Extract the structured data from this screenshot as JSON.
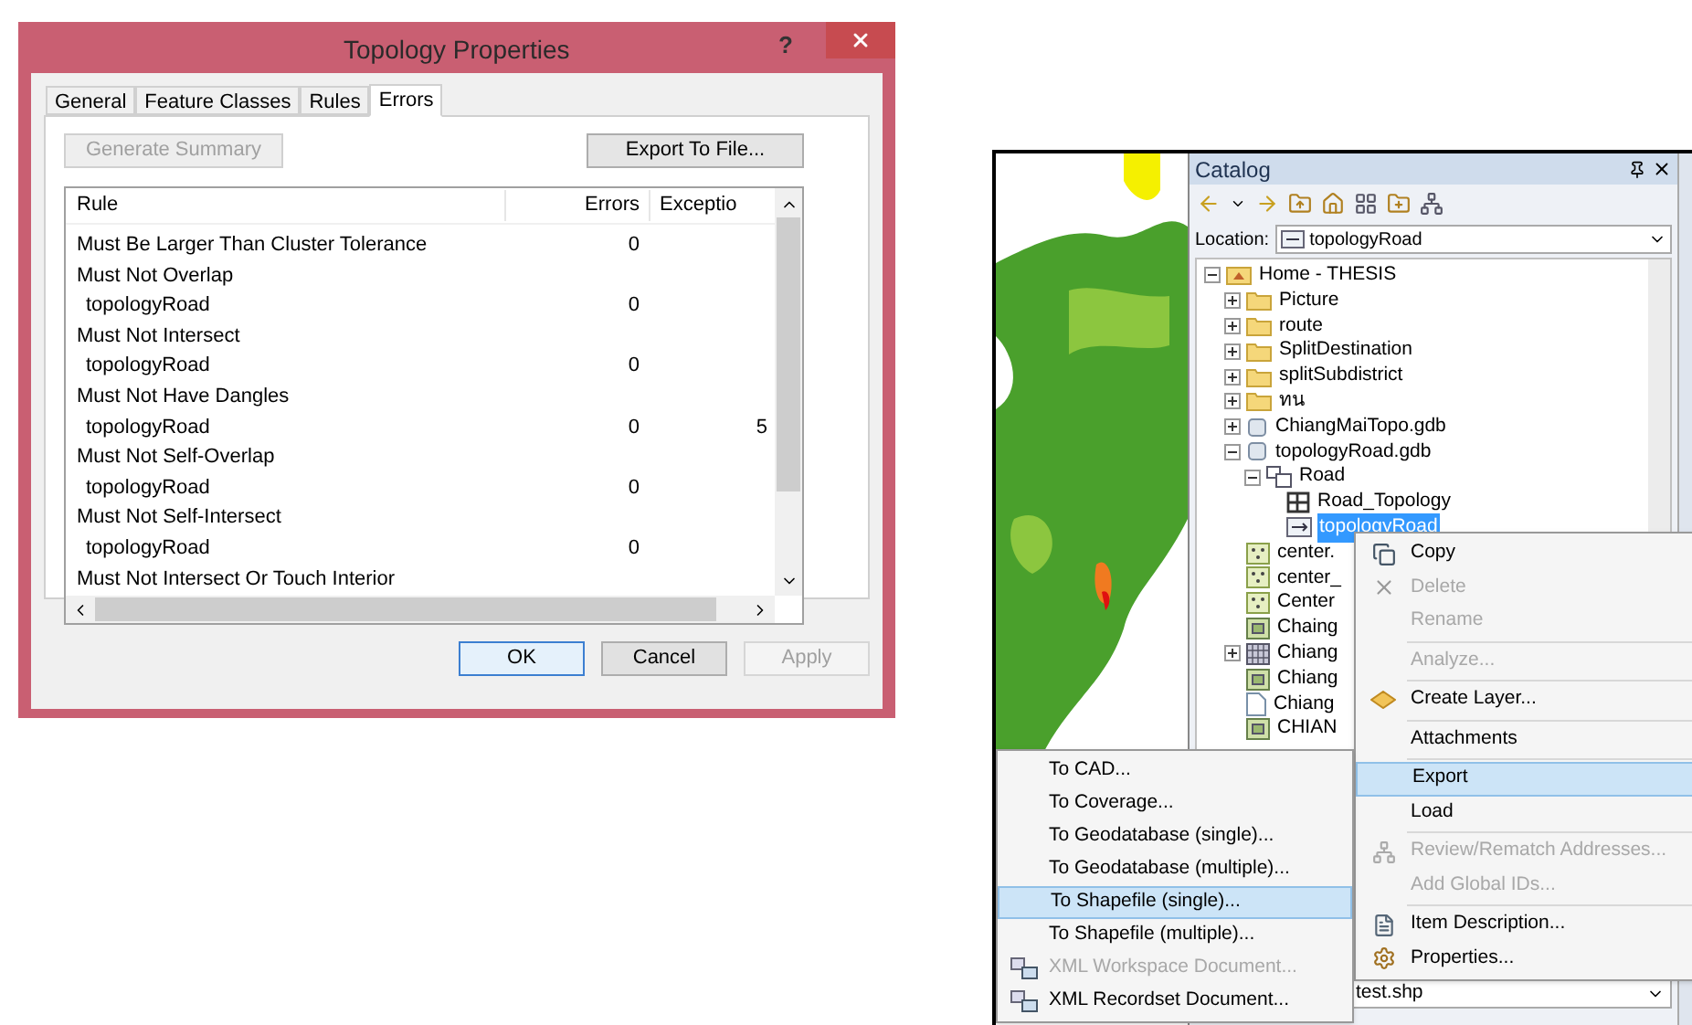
{
  "dialog": {
    "title": "Topology Properties",
    "help": "?",
    "tabs": [
      {
        "label": "General",
        "selected": false
      },
      {
        "label": "Feature Classes",
        "selected": false
      },
      {
        "label": "Rules",
        "selected": false
      },
      {
        "label": "Errors",
        "selected": true
      }
    ],
    "generate_button": {
      "label": "Generate Summary",
      "disabled": true
    },
    "export_button": {
      "label": "Export To File...",
      "disabled": false
    },
    "table": {
      "columns": [
        "Rule",
        "Errors",
        "Exceptio"
      ],
      "rows": [
        {
          "kind": "rule",
          "rule": "Must Be Larger Than Cluster Tolerance",
          "errors": "0"
        },
        {
          "kind": "rule",
          "rule": "Must Not Overlap"
        },
        {
          "kind": "class",
          "rule": "topologyRoad",
          "errors": "0"
        },
        {
          "kind": "rule",
          "rule": "Must Not Intersect"
        },
        {
          "kind": "class",
          "rule": "topologyRoad",
          "errors": "0"
        },
        {
          "kind": "rule",
          "rule": "Must Not Have Dangles"
        },
        {
          "kind": "class",
          "rule": "topologyRoad",
          "errors": "0",
          "exceptions": "5"
        },
        {
          "kind": "rule",
          "rule": "Must Not Self-Overlap"
        },
        {
          "kind": "class",
          "rule": "topologyRoad",
          "errors": "0"
        },
        {
          "kind": "rule",
          "rule": "Must Not Self-Intersect"
        },
        {
          "kind": "class",
          "rule": "topologyRoad",
          "errors": "0"
        },
        {
          "kind": "rule",
          "rule": "Must Not Intersect Or Touch Interior"
        }
      ]
    },
    "footer_buttons": [
      {
        "label": "OK",
        "default": true,
        "disabled": false
      },
      {
        "label": "Cancel",
        "default": false,
        "disabled": false
      },
      {
        "label": "Apply",
        "default": false,
        "disabled": true
      }
    ]
  },
  "catalog": {
    "title": "Catalog",
    "location_label": "Location:",
    "location_value": "topologyRoad",
    "tree": [
      {
        "label": "Home - THESIS",
        "kind": "home",
        "expanded": true,
        "selected": false,
        "children": [
          {
            "label": "Picture",
            "kind": "folder",
            "expanded": false,
            "selected": false
          },
          {
            "label": "route",
            "kind": "folder",
            "expanded": false,
            "selected": false
          },
          {
            "label": "SplitDestination",
            "kind": "folder",
            "expanded": false,
            "selected": false
          },
          {
            "label": "splitSubdistrict",
            "kind": "folder",
            "expanded": false,
            "selected": false
          },
          {
            "label": "ทน",
            "kind": "folder",
            "expanded": false,
            "selected": false
          },
          {
            "label": "ChiangMaiTopo.gdb",
            "kind": "gdb",
            "expanded": false,
            "selected": false
          },
          {
            "label": "topologyRoad.gdb",
            "kind": "gdb",
            "expanded": true,
            "selected": false,
            "children": [
              {
                "label": "Road",
                "kind": "dataset",
                "expanded": true,
                "selected": false,
                "children": [
                  {
                    "label": "Road_Topology",
                    "kind": "topology",
                    "selected": false
                  },
                  {
                    "label": "topologyRoad",
                    "kind": "network",
                    "selected": true
                  }
                ]
              }
            ]
          },
          {
            "label": "center.",
            "kind": "point",
            "selected": false
          },
          {
            "label": "center_",
            "kind": "point",
            "selected": false
          },
          {
            "label": "Center",
            "kind": "point",
            "selected": false
          },
          {
            "label": "Chaing",
            "kind": "raster",
            "selected": false
          },
          {
            "label": "Chiang",
            "kind": "grid",
            "expanded": false,
            "selected": false
          },
          {
            "label": "Chiang",
            "kind": "raster",
            "selected": false
          },
          {
            "label": "Chiang",
            "kind": "doc",
            "selected": false
          },
          {
            "label": "CHIAN",
            "kind": "raster",
            "selected": false
          }
        ]
      }
    ],
    "bottom_field": "test.shp"
  },
  "context_menu": [
    {
      "kind": "copy",
      "label": "Copy",
      "disabled": false,
      "selected": false
    },
    {
      "kind": "delete",
      "label": "Delete",
      "disabled": true,
      "selected": false
    },
    {
      "kind": "item",
      "label": "Rename",
      "disabled": true,
      "selected": false
    },
    {
      "kind": "separator"
    },
    {
      "kind": "item",
      "label": "Analyze...",
      "disabled": true,
      "selected": false
    },
    {
      "kind": "separator"
    },
    {
      "kind": "layer",
      "label": "Create Layer...",
      "disabled": false,
      "selected": false
    },
    {
      "kind": "separator"
    },
    {
      "kind": "item",
      "label": "Attachments",
      "disabled": false,
      "selected": false
    },
    {
      "kind": "separator"
    },
    {
      "kind": "item",
      "label": "Export",
      "disabled": false,
      "selected": true
    },
    {
      "kind": "item",
      "label": "Load",
      "disabled": false,
      "selected": false
    },
    {
      "kind": "separator"
    },
    {
      "kind": "review",
      "label": "Review/Rematch Addresses...",
      "disabled": true,
      "selected": false
    },
    {
      "kind": "item",
      "label": "Add Global IDs...",
      "disabled": true,
      "selected": false
    },
    {
      "kind": "separator"
    },
    {
      "kind": "description",
      "label": "Item Description...",
      "disabled": false,
      "selected": false
    },
    {
      "kind": "properties",
      "label": "Properties...",
      "disabled": false,
      "selected": false
    }
  ],
  "export_submenu": [
    {
      "label": "To CAD...",
      "disabled": false,
      "selected": false
    },
    {
      "label": "To Coverage...",
      "disabled": false,
      "selected": false
    },
    {
      "label": "To Geodatabase (single)...",
      "disabled": false,
      "selected": false
    },
    {
      "label": "To Geodatabase (multiple)...",
      "disabled": false,
      "selected": false
    },
    {
      "label": "To Shapefile (single)...",
      "disabled": false,
      "selected": true
    },
    {
      "label": "To Shapefile (multiple)...",
      "disabled": false,
      "selected": false
    },
    {
      "label": "XML Workspace Document...",
      "kind": "xml",
      "disabled": true,
      "selected": false
    },
    {
      "label": "XML Recordset Document...",
      "kind": "xml",
      "disabled": false,
      "selected": false
    }
  ]
}
